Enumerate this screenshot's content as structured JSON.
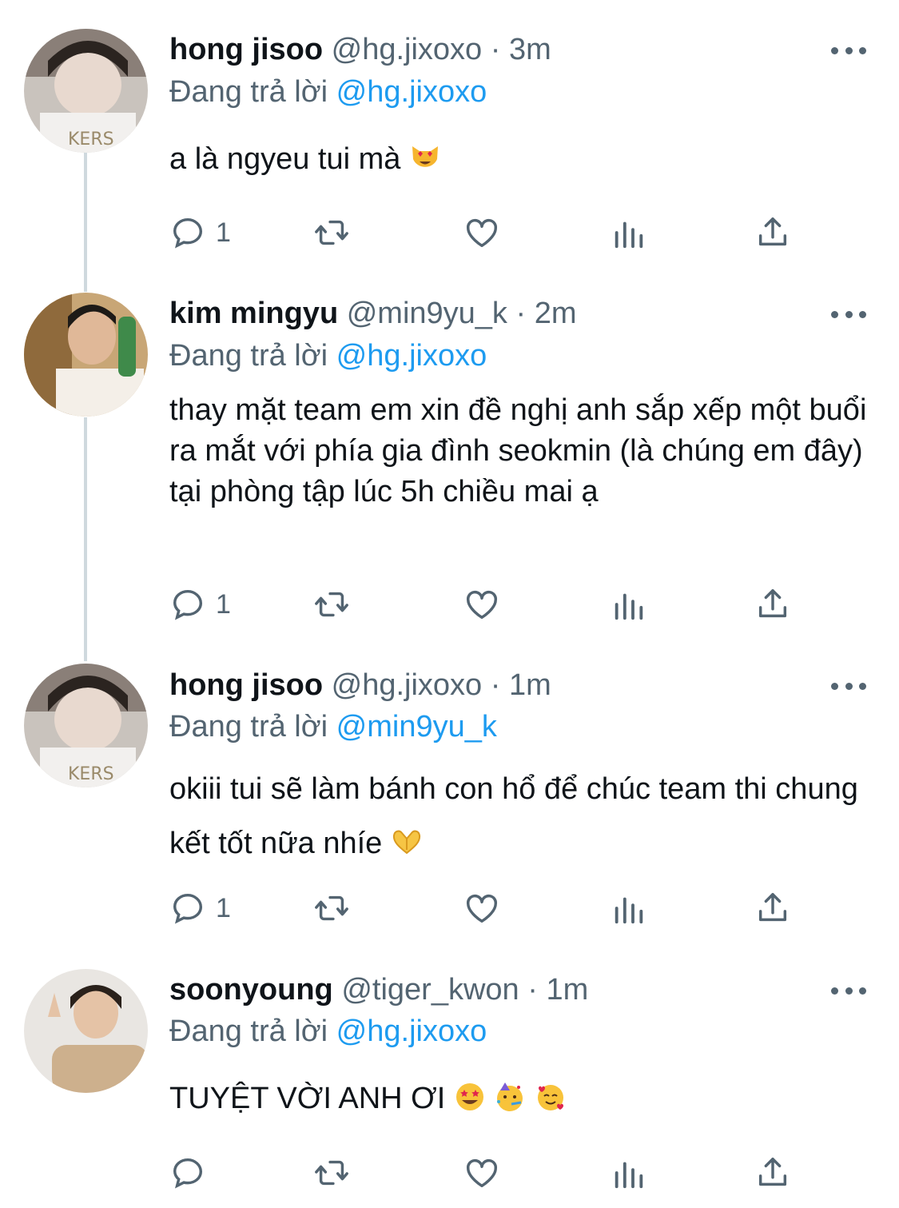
{
  "tweets": [
    {
      "name": "hong jisoo",
      "handle": "@hg.jixoxo",
      "separator": "·",
      "time": "3m",
      "reply_prefix": "Đang trả lời",
      "reply_to": "@hg.jixoxo",
      "text": "a là ngyeu tui mà",
      "emojis": [
        "smiling-cat-heart-eyes"
      ],
      "reply_count": "1"
    },
    {
      "name": "kim mingyu",
      "handle": "@min9yu_k",
      "separator": "·",
      "time": "2m",
      "reply_prefix": "Đang trả lời",
      "reply_to": "@hg.jixoxo",
      "text": "thay mặt team em xin đề nghị anh sắp xếp một buổi ra mắt với phía gia đình seokmin (là chúng em đây) tại phòng tập lúc 5h chiều mai ạ",
      "emojis": [],
      "reply_count": "1"
    },
    {
      "name": "hong jisoo",
      "handle": "@hg.jixoxo",
      "separator": "·",
      "time": "1m",
      "reply_prefix": "Đang trả lời",
      "reply_to": "@min9yu_k",
      "text": "okiii tui sẽ làm bánh con hổ để chúc team thi chung kết tốt nữa nhíe",
      "emojis": [
        "heart-hands"
      ],
      "reply_count": "1"
    },
    {
      "name": "soonyoung",
      "handle": "@tiger_kwon",
      "separator": "·",
      "time": "1m",
      "reply_prefix": "Đang trả lời",
      "reply_to": "@hg.jixoxo",
      "text": "TUYỆT VỜI ANH ƠI",
      "emojis": [
        "star-struck",
        "partying-face",
        "smiling-face-with-hearts"
      ],
      "reply_count": ""
    }
  ],
  "icons": {
    "reply": "reply-icon",
    "retweet": "retweet-icon",
    "like": "like-icon",
    "views": "views-icon",
    "share": "share-icon",
    "more": "more-icon"
  },
  "colors": {
    "text": "#0f1419",
    "secondary": "#536471",
    "link": "#1d9bf0",
    "thread_line": "#cfd9de"
  }
}
